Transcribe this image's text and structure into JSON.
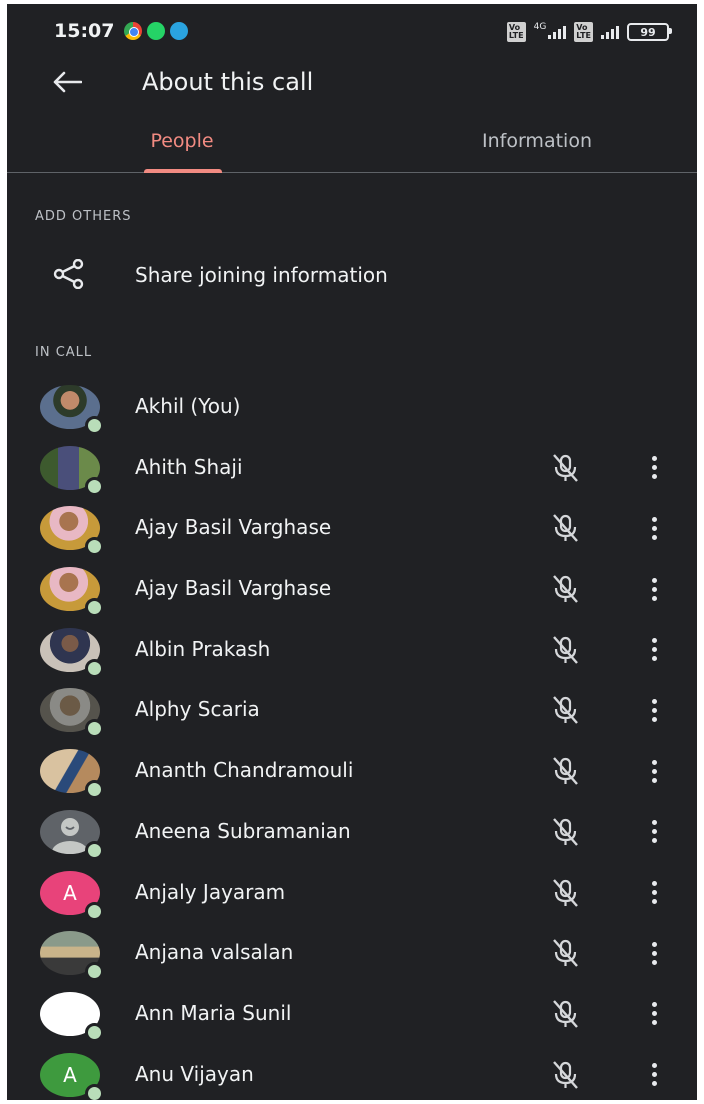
{
  "status_bar": {
    "time": "15:07",
    "notification_icons": [
      "chrome-icon",
      "whatsapp-icon",
      "telegram-icon"
    ],
    "network_label": "4G",
    "battery_level": "99"
  },
  "app_bar": {
    "title": "About this call"
  },
  "tabs": [
    {
      "label": "People",
      "active": true
    },
    {
      "label": "Information",
      "active": false
    }
  ],
  "add_others": {
    "header": "ADD OTHERS",
    "share_label": "Share joining information"
  },
  "in_call": {
    "header": "IN CALL",
    "participants": [
      {
        "name": "Akhil (You)",
        "avatar": "photo",
        "muted_icon": false,
        "more": false
      },
      {
        "name": "Ahith Shaji",
        "avatar": "photo",
        "muted_icon": true,
        "more": true
      },
      {
        "name": "Ajay Basil Varghase",
        "avatar": "photo",
        "muted_icon": true,
        "more": true
      },
      {
        "name": "Ajay Basil Varghase",
        "avatar": "photo",
        "muted_icon": true,
        "more": true
      },
      {
        "name": "Albin Prakash",
        "avatar": "photo",
        "muted_icon": true,
        "more": true
      },
      {
        "name": "Alphy Scaria",
        "avatar": "photo",
        "muted_icon": true,
        "more": true
      },
      {
        "name": "Ananth Chandramouli",
        "avatar": "photo",
        "muted_icon": true,
        "more": true
      },
      {
        "name": "Aneena Subramanian",
        "avatar": "default",
        "muted_icon": true,
        "more": true
      },
      {
        "name": "Anjaly Jayaram",
        "avatar": "letter",
        "letter": "A",
        "muted_icon": true,
        "more": true
      },
      {
        "name": "Anjana valsalan",
        "avatar": "photo",
        "muted_icon": true,
        "more": true
      },
      {
        "name": "Ann Maria Sunil",
        "avatar": "photo",
        "muted_icon": true,
        "more": true
      },
      {
        "name": "Anu Vijayan",
        "avatar": "letter",
        "letter": "A",
        "muted_icon": true,
        "more": true
      }
    ]
  },
  "colors": {
    "background": "#202124",
    "accent": "#f28b82",
    "text": "#f1f3f4",
    "presence": "#b9ddb9",
    "letter_avatar_pink": "#e8437a",
    "letter_avatar_green": "#3e9a3e"
  }
}
